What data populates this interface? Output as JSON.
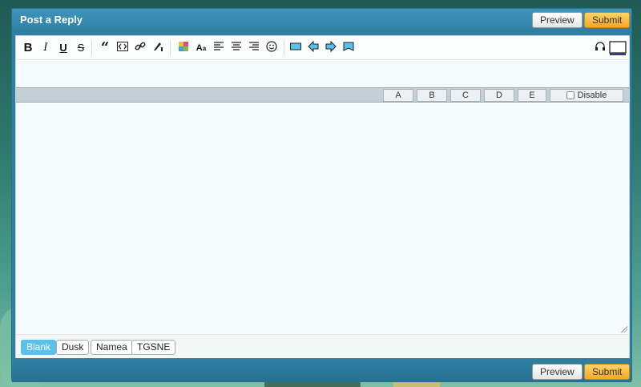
{
  "panel": {
    "title": "Post a Reply",
    "preview_label": "Preview",
    "submit_label": "Submit"
  },
  "toolbar": {
    "bold": "B",
    "italic": "I",
    "underline": "U",
    "strike": "S"
  },
  "columns": [
    "A",
    "B",
    "C",
    "D",
    "E"
  ],
  "disable_label": "Disable",
  "templates": [
    {
      "label": "Blank",
      "active": true
    },
    {
      "label": "Dusk",
      "active": false
    },
    {
      "label": "Namea",
      "active": false
    },
    {
      "label": "TGSNE",
      "active": false
    }
  ],
  "colors": {
    "header_blue": "#2f7fa3",
    "submit_orange": "#f3a824",
    "active_template": "#5bc0ea"
  }
}
